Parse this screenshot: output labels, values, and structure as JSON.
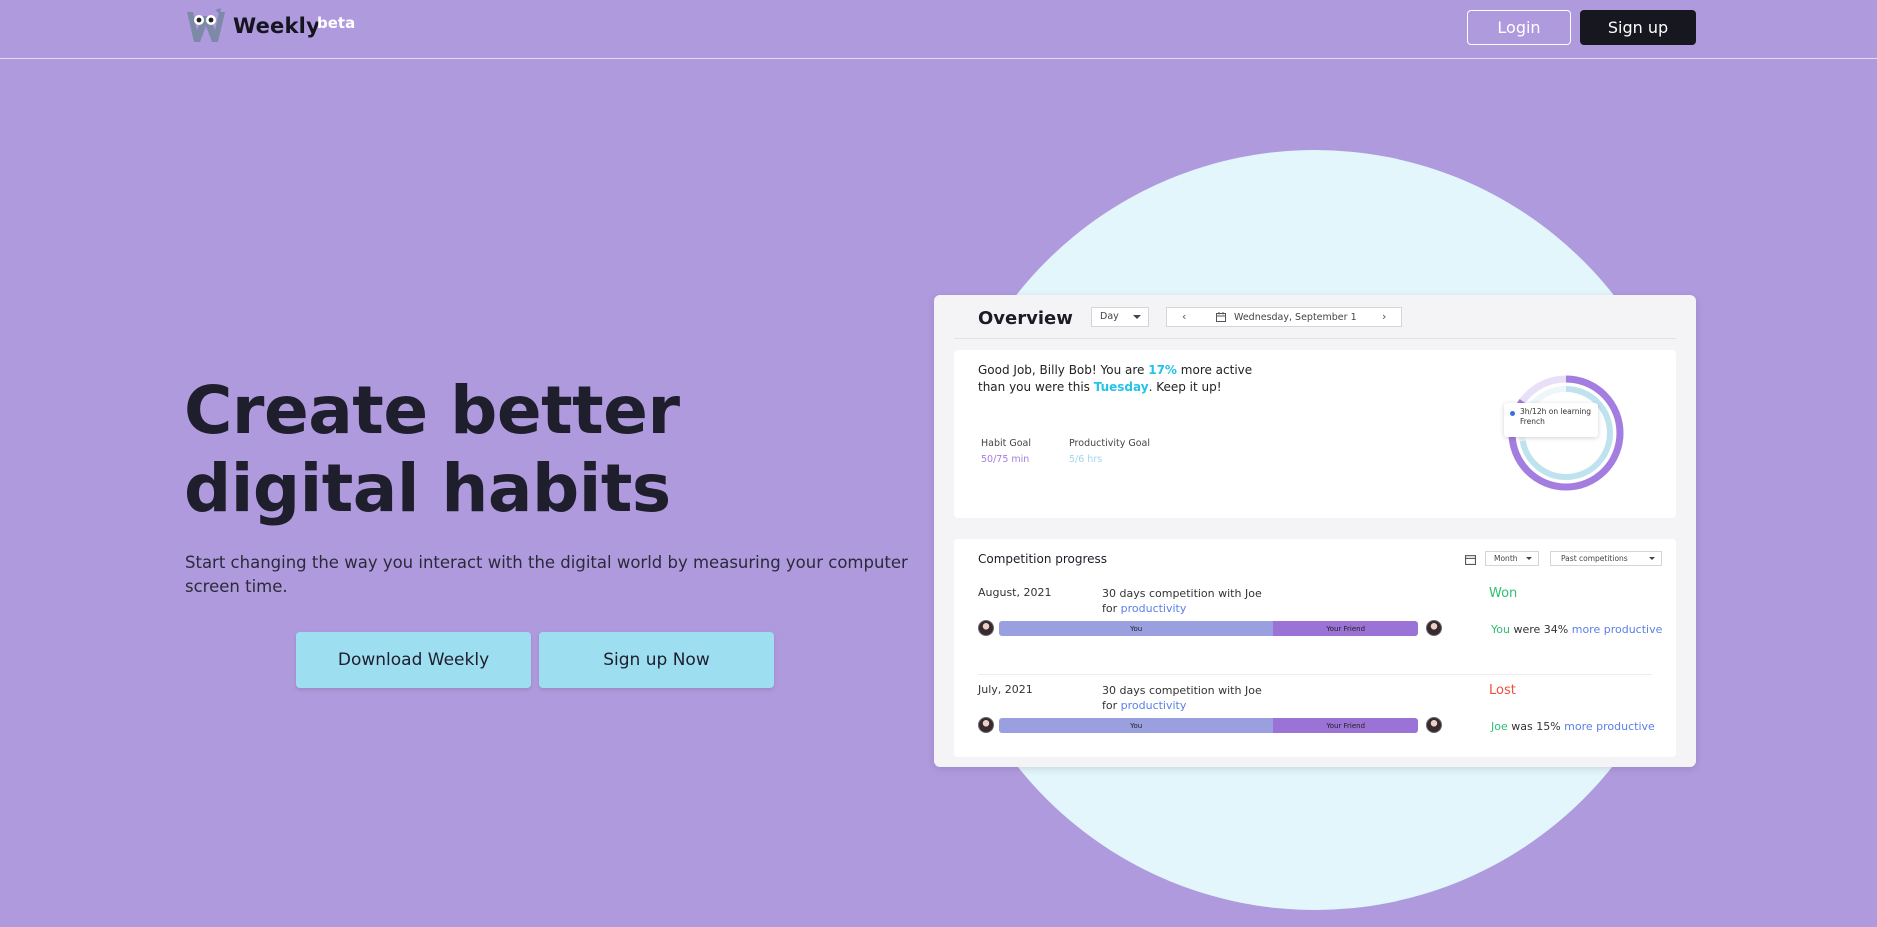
{
  "nav": {
    "brand": "Weekly",
    "badge": "beta",
    "login_label": "Login",
    "signup_label": "Sign up"
  },
  "hero": {
    "title": "Create better digital habits",
    "subtitle": "Start changing the way you interact with the digital world by measuring your computer screen time.",
    "download_label": "Download Weekly",
    "signup_now_label": "Sign up Now"
  },
  "dashboard": {
    "title": "Overview",
    "period_select": "Day",
    "date": "Wednesday, September 1",
    "message": {
      "part1": "Good Job, Billy Bob! You are ",
      "percent": "17%",
      "part2": " more active than you were this ",
      "day": "Tuesday",
      "part3": ". Keep it up!"
    },
    "habit_goal": {
      "label": "Habit Goal",
      "value": "50/75 min"
    },
    "productivity_goal": {
      "label": "Productivity Goal",
      "value": "5/6 hrs"
    },
    "tooltip": "3h/12h on learning French",
    "donut": {
      "outer_fraction": 0.85,
      "inner_fraction": 0.72,
      "outer_color": "#a47de0",
      "inner_color": "#bfe3ee"
    },
    "competition": {
      "title": "Competition progress",
      "month_select": "Month",
      "past_select": "Past competitions",
      "rows": [
        {
          "date": "August, 2021",
          "desc": "30 days competition with Joe",
          "desc_for": "for ",
          "desc_link": "productivity",
          "status": "Won",
          "you_label": "You",
          "friend_label": "Your Friend",
          "you_share": 0.655,
          "result_who": "You",
          "result_mid": " were 34% ",
          "result_link": "more productive"
        },
        {
          "date": "July, 2021",
          "desc": "30 days competition with Joe",
          "desc_for": "for ",
          "desc_link": "productivity",
          "status": "Lost",
          "you_label": "You",
          "friend_label": "Your Friend",
          "you_share": 0.655,
          "result_who": "Joe",
          "result_mid": " was 15% ",
          "result_link": "more productive"
        }
      ]
    }
  },
  "colors": {
    "background": "#b09ade",
    "circle": "#e2f6fc",
    "cta": "#9ddff0",
    "highlight": "#25c3e8",
    "won": "#2fbf71",
    "lost": "#f24e3b"
  }
}
